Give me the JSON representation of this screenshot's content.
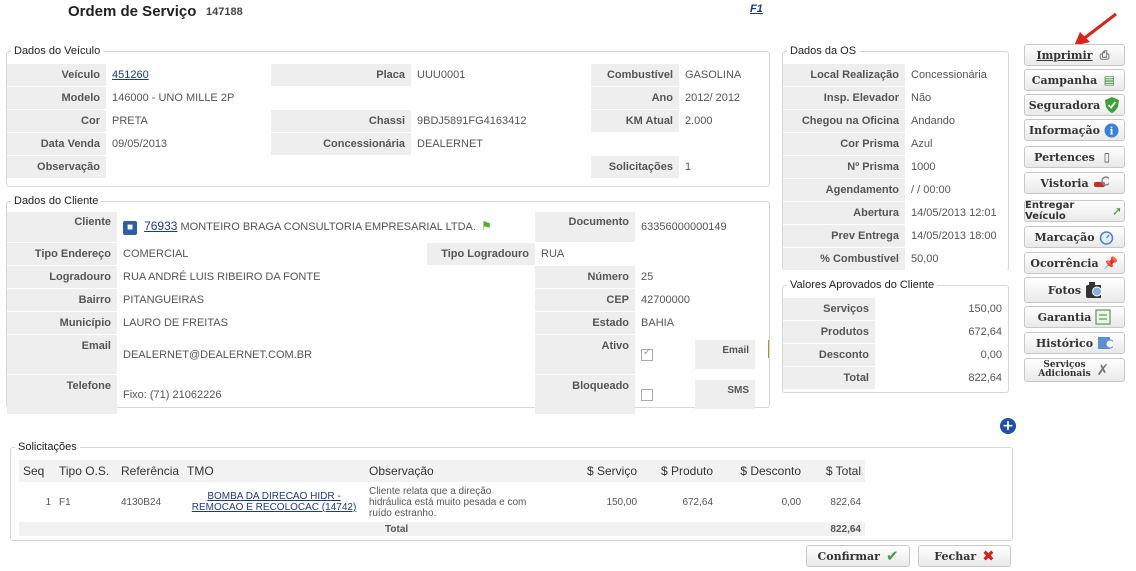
{
  "header": {
    "title": "Ordem de Serviço",
    "os_number": "147188",
    "help_link": "F1"
  },
  "veiculo": {
    "legend": "Dados do Veículo",
    "veiculo_label": "Veículo",
    "veiculo_value": "451260",
    "placa_label": "Placa",
    "placa_value": "UUU0001",
    "combustivel_label": "Combustível",
    "combustivel_value": "GASOLINA",
    "modelo_label": "Modelo",
    "modelo_value": "146000 - UNO MILLE 2P",
    "ano_label": "Ano",
    "ano_value": "2012/ 2012",
    "cor_label": "Cor",
    "cor_value": "PRETA",
    "chassi_label": "Chassi",
    "chassi_value": "9BDJ5891FG4163412",
    "km_label": "KM Atual",
    "km_value": "2.000",
    "data_venda_label": "Data Venda",
    "data_venda_value": "09/05/2013",
    "concessionaria_label": "Concessionária",
    "concessionaria_value": "DEALERNET",
    "observacao_label": "Observação",
    "observacao_value": "",
    "solicitacoes_label": "Solicitações",
    "solicitacoes_value": "1"
  },
  "cliente": {
    "legend": "Dados do Cliente",
    "cliente_label": "Cliente",
    "cliente_code": "76933",
    "cliente_name": "MONTEIRO BRAGA CONSULTORIA EMPRESARIAL LTDA.",
    "documento_label": "Documento",
    "documento_value": "63356000000149",
    "tipo_endereco_label": "Tipo Endereço",
    "tipo_endereco_value": "COMERCIAL",
    "tipo_logradouro_label": "Tipo Logradouro",
    "tipo_logradouro_value": "RUA",
    "logradouro_label": "Logradouro",
    "logradouro_value": "RUA ANDRÉ LUIS RIBEIRO DA FONTE",
    "numero_label": "Número",
    "numero_value": "25",
    "bairro_label": "Bairro",
    "bairro_value": "PITANGUEIRAS",
    "cep_label": "CEP",
    "cep_value": "42700000",
    "municipio_label": "Município",
    "municipio_value": "LAURO DE FREITAS",
    "estado_label": "Estado",
    "estado_value": "BAHIA",
    "email_label": "Email",
    "email_value": "DEALERNET@DEALERNET.COM.BR",
    "ativo_label": "Ativo",
    "email2_label": "Email",
    "telefone_label": "Telefone",
    "telefone_value": "Fixo: (71) 21062226",
    "bloqueado_label": "Bloqueado",
    "sms_label": "SMS"
  },
  "os": {
    "legend": "Dados da OS",
    "rows": [
      {
        "label": "Local Realização",
        "value": "Concessionária"
      },
      {
        "label": "Insp. Elevador",
        "value": "Não"
      },
      {
        "label": "Chegou na Oficina",
        "value": "Andando"
      },
      {
        "label": "Cor Prisma",
        "value": "Azul"
      },
      {
        "label": "Nº Prisma",
        "value": "1000"
      },
      {
        "label": "Agendamento",
        "value": "/ / 00:00"
      },
      {
        "label": "Abertura",
        "value": "14/05/2013 12:01"
      },
      {
        "label": "Prev Entrega",
        "value": "14/05/2013 18:00"
      },
      {
        "label": "% Combustível",
        "value": "50,00"
      }
    ]
  },
  "valores": {
    "legend": "Valores Aprovados do Cliente",
    "rows": [
      {
        "label": "Serviços",
        "value": "150,00"
      },
      {
        "label": "Produtos",
        "value": "672,64"
      },
      {
        "label": "Desconto",
        "value": "0,00"
      },
      {
        "label": "Total",
        "value": "822,64"
      }
    ]
  },
  "side_buttons": {
    "imprimir": "Imprimir",
    "campanha": "Campanha",
    "seguradora": "Seguradora",
    "informacao": "Informação",
    "pertences": "Pertences",
    "vistoria": "Vistoria",
    "entregar": "Entregar Veículo",
    "marcacao": "Marcação",
    "ocorrencia": "Ocorrência",
    "fotos": "Fotos",
    "garantia": "Garantia",
    "historico": "Histórico",
    "servicos_adicionais_1": "Serviços",
    "servicos_adicionais_2": "Adicionais"
  },
  "solicitacoes": {
    "legend": "Solicitações",
    "columns": [
      "Seq",
      "Tipo O.S.",
      "Referência",
      "TMO",
      "Observação",
      "$ Serviço",
      "$ Produto",
      "$ Desconto",
      "$ Total"
    ],
    "row": {
      "seq": "1",
      "tipo": "F1",
      "referencia": "4130B24",
      "tmo_1": "BOMBA DA DIRECAO HIDR -",
      "tmo_2": "REMOCAO E RECOLOCAC (14742)",
      "obs_1": "Cliente relata que a direção",
      "obs_2": "hidráulica está muito pesada e com",
      "obs_3": "ruído estranho.",
      "servico": "150,00",
      "produto": "672,64",
      "desconto": "0,00",
      "total": "822,64"
    },
    "total_label": "Total",
    "total_value": "822,64"
  },
  "actions": {
    "confirmar": "Confirmar",
    "fechar": "Fechar"
  },
  "colors": {
    "link": "#1a3b8a",
    "label_bg": "#eeeeee",
    "arrow": "#d9231b",
    "add_icon": "#1f4fa8"
  }
}
